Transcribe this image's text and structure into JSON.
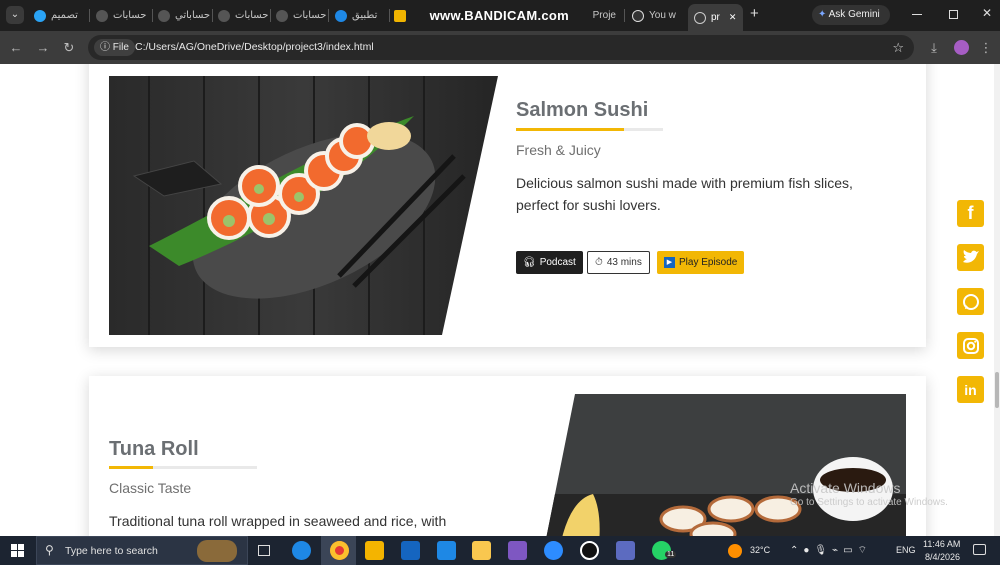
{
  "browser": {
    "tabs": [
      {
        "label": "تصميم",
        "color": "#2aa3f5"
      },
      {
        "label": "حسابات",
        "color": "#777"
      },
      {
        "label": "حساباتي",
        "color": "#777"
      },
      {
        "label": "حسابات",
        "color": "#777"
      },
      {
        "label": "حسابات",
        "color": "#777"
      },
      {
        "label": "تطبيق",
        "color": "#1e88e5"
      },
      {
        "label": "Proje",
        "color": "#f0b400"
      },
      {
        "label": "You w",
        "color": "#ddd"
      }
    ],
    "active_tab": {
      "label": "pr",
      "close": "✕"
    },
    "new_tab": "+",
    "ask_gemini": "Ask Gemini",
    "watermark": "www.BANDICAM.com",
    "file_chip": "File",
    "url": "C:/Users/AG/OneDrive/Desktop/project3/index.html"
  },
  "cards": [
    {
      "title": "Salmon Sushi",
      "subtitle": "Fresh & Juicy",
      "description_lines": [
        "Delicious salmon sushi made with premium fish slices,",
        "perfect for sushi lovers."
      ],
      "buttons": {
        "podcast": "Podcast",
        "duration": "43 mins",
        "play": "Play Episode"
      }
    },
    {
      "title": "Tuna Roll",
      "subtitle": "Classic Taste",
      "description_lines": [
        "Traditional tuna roll wrapped in seaweed and rice, with"
      ]
    }
  ],
  "social_icons": [
    "facebook-icon",
    "twitter-icon",
    "whatsapp-icon",
    "instagram-icon",
    "linkedin-icon"
  ],
  "windows_watermark": {
    "line1": "Activate Windows",
    "line2": "Go to Settings to activate Windows."
  },
  "taskbar": {
    "search_placeholder": "Type here to search",
    "weather": "32°C",
    "language": "ENG",
    "time": "11:46 AM",
    "date": "8/4/2026",
    "whatsapp_badge": "11"
  },
  "colors": {
    "accent": "#f2b705",
    "dark": "#1f1f1f"
  }
}
